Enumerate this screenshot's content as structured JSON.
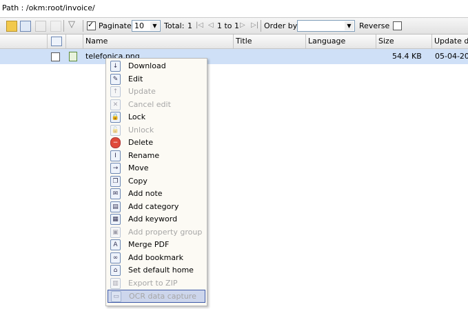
{
  "path_label": "Path : /okm:root/invoice/",
  "toolbar": {
    "paginate_label": "Paginate",
    "page_size": "10",
    "total_label": "Total:",
    "total_value": "1",
    "range_label": "1 to 1",
    "order_by_label": "Order by",
    "order_by_value": "",
    "reverse_label": "Reverse"
  },
  "columns": [
    "Name",
    "Title",
    "Language",
    "Size",
    "Update da"
  ],
  "row": {
    "name": "telefonica.png",
    "title": "",
    "language": "",
    "size": "54.4 KB",
    "update": "05-04-20"
  },
  "context_menu": [
    {
      "label": "Download",
      "enabled": true
    },
    {
      "label": "Edit",
      "enabled": true
    },
    {
      "label": "Update",
      "enabled": false
    },
    {
      "label": "Cancel edit",
      "enabled": false
    },
    {
      "label": "Lock",
      "enabled": true
    },
    {
      "label": "Unlock",
      "enabled": false
    },
    {
      "label": "Delete",
      "enabled": true
    },
    {
      "label": "Rename",
      "enabled": true
    },
    {
      "label": "Move",
      "enabled": true
    },
    {
      "label": "Copy",
      "enabled": true
    },
    {
      "label": "Add note",
      "enabled": true
    },
    {
      "label": "Add category",
      "enabled": true
    },
    {
      "label": "Add keyword",
      "enabled": true
    },
    {
      "label": "Add property group",
      "enabled": false
    },
    {
      "label": "Merge PDF",
      "enabled": true
    },
    {
      "label": "Add bookmark",
      "enabled": true
    },
    {
      "label": "Set default home",
      "enabled": true
    },
    {
      "label": "Export to ZIP",
      "enabled": false
    },
    {
      "label": "OCR data capture",
      "enabled": false,
      "highlighted": true
    }
  ]
}
